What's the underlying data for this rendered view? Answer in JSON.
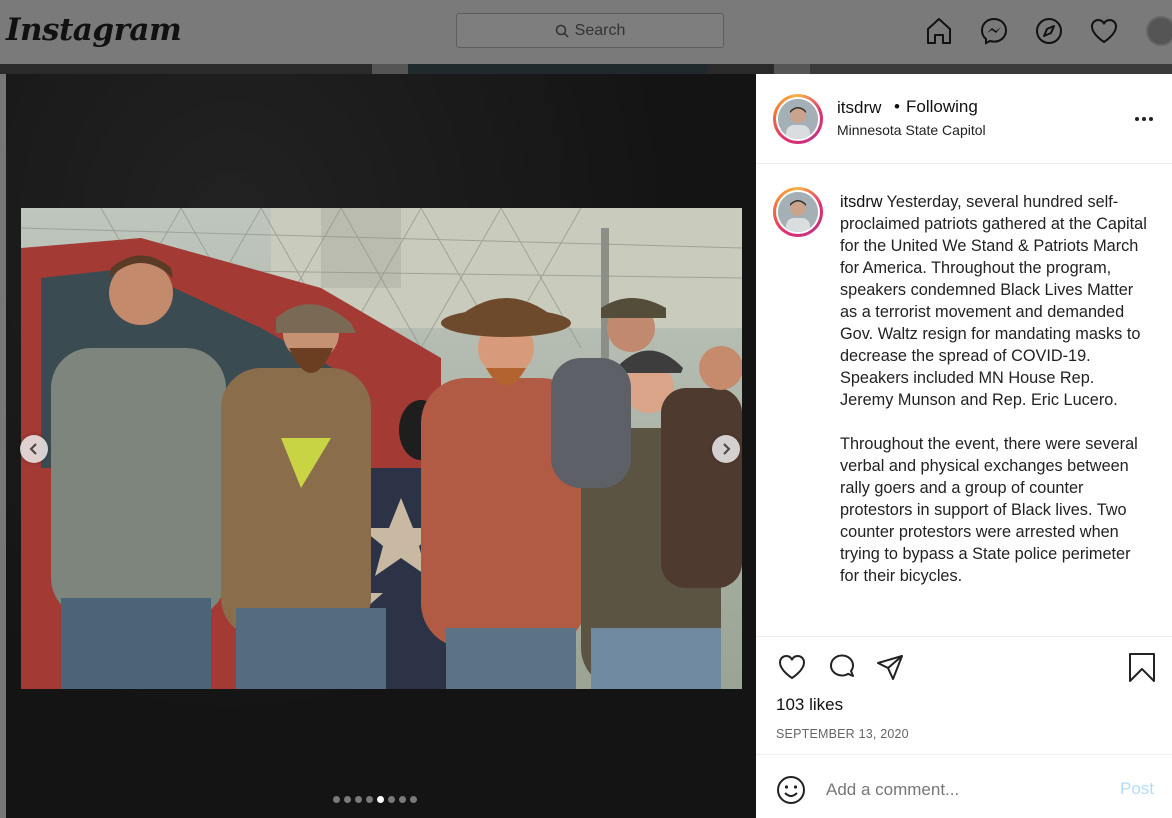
{
  "nav": {
    "logo": "Instagram",
    "search_placeholder": "Search",
    "icons": [
      "home-icon",
      "messenger-icon",
      "explore-icon",
      "activity-heart-icon",
      "profile-avatar"
    ]
  },
  "post": {
    "username": "itsdrw",
    "separator": "•",
    "follow_status": "Following",
    "location": "Minnesota State Capitol",
    "caption_username": "itsdrw",
    "caption_p1": "Yesterday, several hundred self-proclaimed patriots gathered at the Capital for the United We Stand & Patriots March for America. Throughout the program, speakers condemned Black Lives Matter as a terrorist movement and demanded Gov. Waltz resign for mandating masks to decrease the spread of COVID-19. Speakers included MN House Rep. Jeremy Munson and Rep. Eric Lucero.",
    "caption_p2": "Throughout the event, there were several verbal and physical exchanges between rally goers and a group of counter protestors in support of Black lives. Two counter protestors were arrested when trying to bypass a State police perimeter for their bicycles.",
    "likes": "103 likes",
    "date": "SEPTEMBER 13, 2020",
    "carousel": {
      "total": 8,
      "active_index": 4
    }
  },
  "comment_box": {
    "placeholder": "Add a comment...",
    "post_label": "Post"
  },
  "colors": {
    "overlay_bg": "#777777",
    "post_button": "#b3dbff",
    "story_ring": "#e1306c"
  }
}
